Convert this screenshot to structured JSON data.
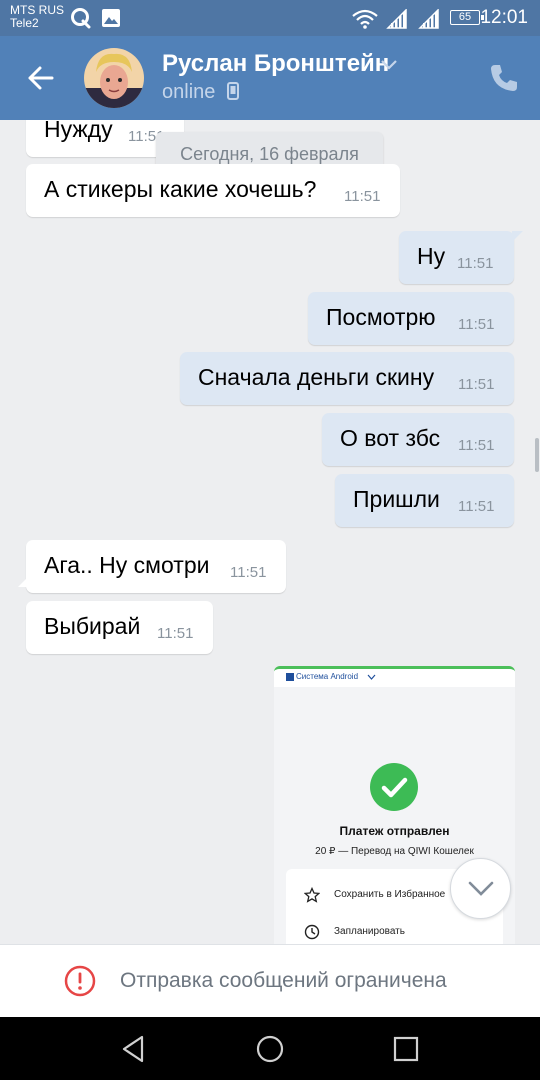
{
  "status_bar": {
    "carrier1": "MTS RUS",
    "carrier2": "Tele2",
    "battery": "65",
    "time": "12:01"
  },
  "header": {
    "contact_name": "Руслан Бронштейн",
    "status": "online"
  },
  "chat": {
    "date_separator": "Сегодня, 16 февраля",
    "messages": [
      {
        "direction": "in",
        "text": "Нужду",
        "time": "11:51"
      },
      {
        "direction": "in",
        "text": "А стикеры какие хочешь?",
        "time": "11:51"
      },
      {
        "direction": "out",
        "text": "Ну",
        "time": "11:51"
      },
      {
        "direction": "out",
        "text": "Посмотрю",
        "time": "11:51"
      },
      {
        "direction": "out",
        "text": "Сначала деньги скину",
        "time": "11:51"
      },
      {
        "direction": "out",
        "text": "О вот збс",
        "time": "11:51"
      },
      {
        "direction": "out",
        "text": "Пришли",
        "time": "11:51"
      },
      {
        "direction": "in",
        "text": "Ага.. Ну смотри",
        "time": "11:51"
      },
      {
        "direction": "in",
        "text": "Выбирай",
        "time": "11:51"
      }
    ],
    "attachment": {
      "top_label": "Система Android",
      "title": "Платеж отправлен",
      "subtitle": "20 ₽ — Перевод на QIWI Кошелек",
      "row1": "Сохранить в Избранное",
      "row2": "Запланировать"
    }
  },
  "footer": {
    "restricted_text": "Отправка сообщений ограничена"
  },
  "colors": {
    "header_bg": "#5181b8",
    "statusbar_bg": "#4f76a4",
    "chat_bg": "#edeef0",
    "outgoing_bubble": "#dde7f3",
    "incoming_bubble": "#ffffff",
    "warning_red": "#e64646"
  }
}
